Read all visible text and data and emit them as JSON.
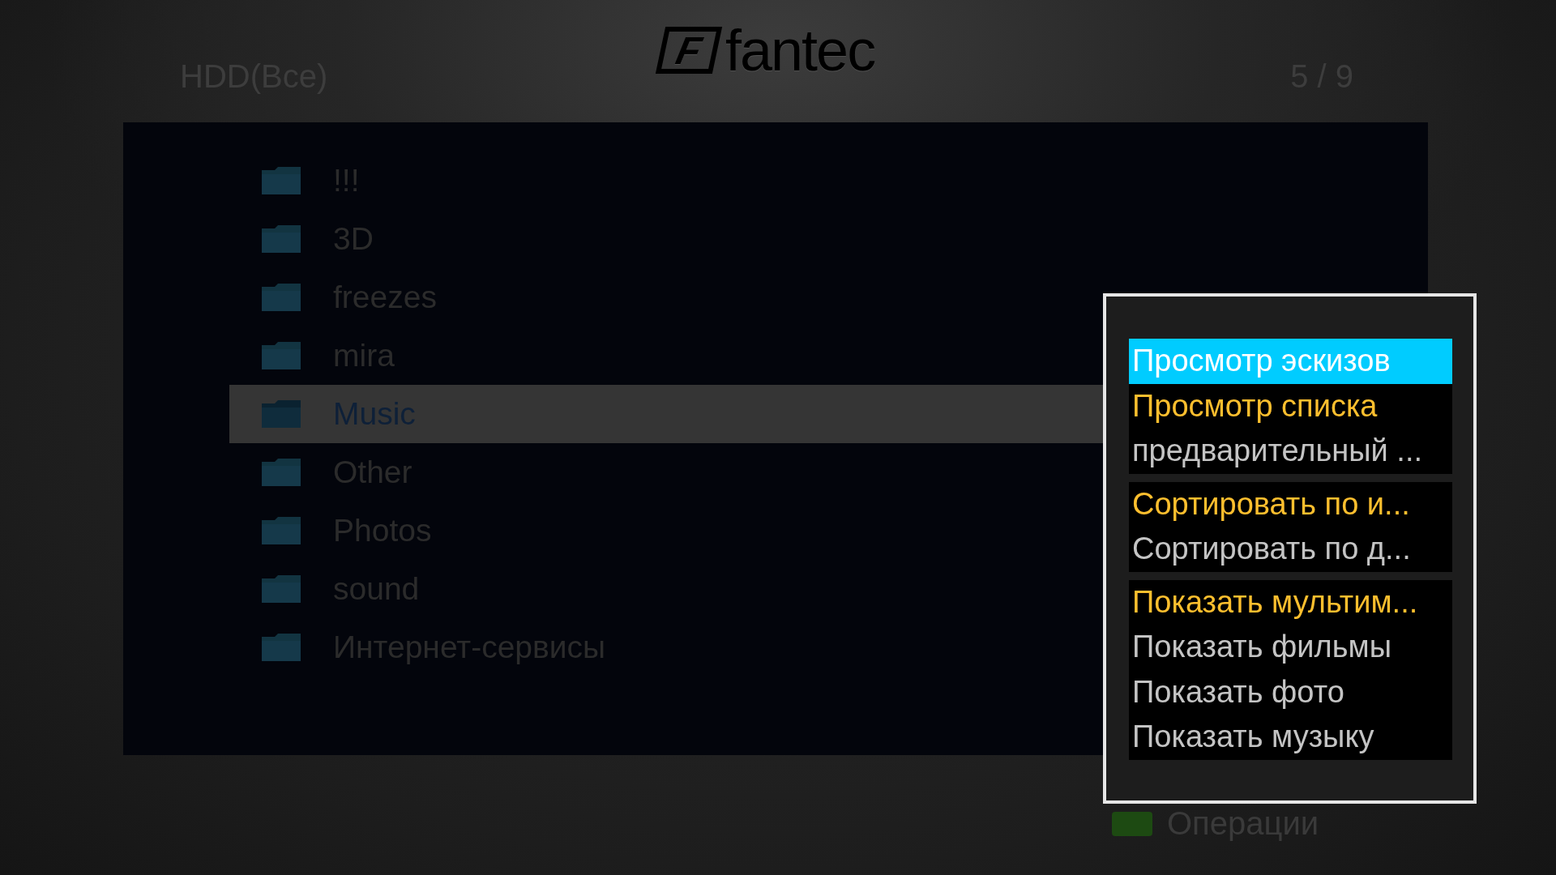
{
  "header": {
    "source": "HDD(Все)",
    "logo": {
      "mark": "F",
      "name": "fantec"
    },
    "page": "5 / 9"
  },
  "folders": [
    {
      "name": "!!!",
      "selected": false
    },
    {
      "name": "3D",
      "selected": false
    },
    {
      "name": "freezes",
      "selected": false
    },
    {
      "name": "mira",
      "selected": false
    },
    {
      "name": "Music",
      "selected": true
    },
    {
      "name": "Other",
      "selected": false
    },
    {
      "name": "Photos",
      "selected": false
    },
    {
      "name": "sound",
      "selected": false
    },
    {
      "name": "Интернет-сервисы",
      "selected": false
    }
  ],
  "footer": {
    "hint": "Операции"
  },
  "menu": {
    "groups": [
      {
        "items": [
          {
            "label": "Просмотр эскизов",
            "selected": true,
            "current": false
          },
          {
            "label": "Просмотр списка",
            "selected": false,
            "current": true
          },
          {
            "label": "предварительный ...",
            "selected": false,
            "current": false
          }
        ]
      },
      {
        "items": [
          {
            "label": "Сортировать по и...",
            "selected": false,
            "current": true
          },
          {
            "label": "Сортировать по д...",
            "selected": false,
            "current": false
          }
        ]
      },
      {
        "items": [
          {
            "label": "Показать мультим...",
            "selected": false,
            "current": true
          },
          {
            "label": "Показать фильмы",
            "selected": false,
            "current": false
          },
          {
            "label": "Показать фото",
            "selected": false,
            "current": false
          },
          {
            "label": "Показать музыку",
            "selected": false,
            "current": false
          }
        ]
      }
    ]
  }
}
